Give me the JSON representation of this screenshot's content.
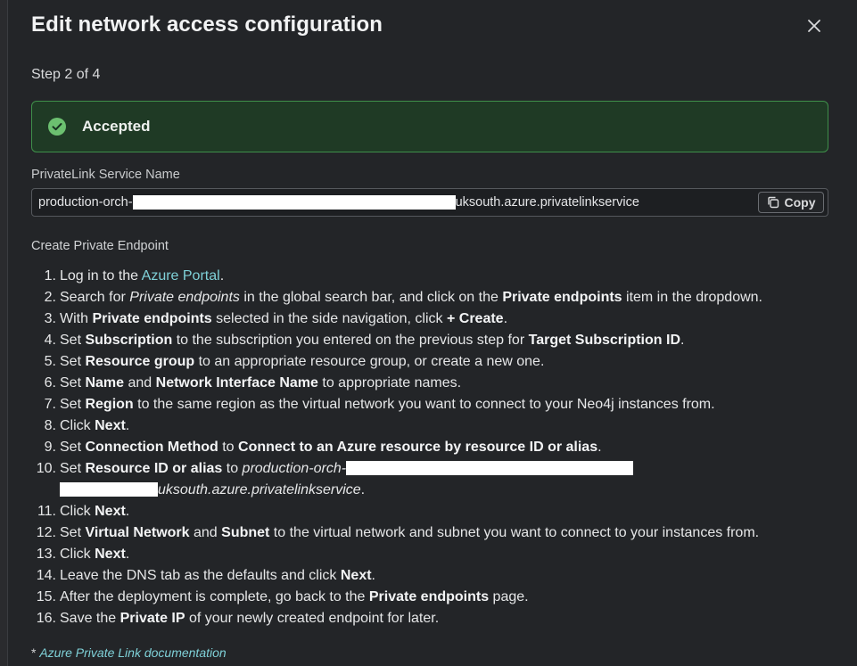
{
  "dialog": {
    "title": "Edit network access configuration",
    "step": "Step 2 of 4",
    "status": "Accepted",
    "colors": {
      "accent_link": "#7fd1d8",
      "success": "#3f8f4a",
      "background": "#232528"
    }
  },
  "service": {
    "label": "PrivateLink Service Name",
    "value_prefix": "production-orch-",
    "value_suffix": "uksouth.azure.privatelinkservice",
    "copy_label": "Copy"
  },
  "endpoint": {
    "heading": "Create Private Endpoint",
    "steps": [
      {
        "n": "1.",
        "parts": [
          [
            "Log in to the ",
            ""
          ],
          [
            "Azure Portal",
            "link"
          ],
          [
            ".",
            ""
          ]
        ]
      },
      {
        "n": "2.",
        "parts": [
          [
            "Search for ",
            ""
          ],
          [
            "Private endpoints",
            "i"
          ],
          [
            " in the global search bar, and click on the ",
            ""
          ],
          [
            "Private endpoints",
            "b"
          ],
          [
            " item in the dropdown.",
            ""
          ]
        ]
      },
      {
        "n": "3.",
        "parts": [
          [
            "With ",
            ""
          ],
          [
            "Private endpoints",
            "b"
          ],
          [
            " selected in the side navigation, click ",
            ""
          ],
          [
            "+ Create",
            "b"
          ],
          [
            ".",
            ""
          ]
        ]
      },
      {
        "n": "4.",
        "parts": [
          [
            "Set ",
            ""
          ],
          [
            "Subscription",
            "b"
          ],
          [
            " to the subscription you entered on the previous step for ",
            ""
          ],
          [
            "Target Subscription ID",
            "b"
          ],
          [
            ".",
            ""
          ]
        ]
      },
      {
        "n": "5.",
        "parts": [
          [
            "Set ",
            ""
          ],
          [
            "Resource group",
            "b"
          ],
          [
            " to an appropriate resource group, or create a new one.",
            ""
          ]
        ]
      },
      {
        "n": "6.",
        "parts": [
          [
            "Set ",
            ""
          ],
          [
            "Name",
            "b"
          ],
          [
            " and ",
            ""
          ],
          [
            "Network Interface Name",
            "b"
          ],
          [
            " to appropriate names.",
            ""
          ]
        ]
      },
      {
        "n": "7.",
        "parts": [
          [
            "Set ",
            ""
          ],
          [
            "Region",
            "b"
          ],
          [
            " to the same region as the virtual network you want to connect to your Neo4j instances from.",
            ""
          ]
        ]
      },
      {
        "n": "8.",
        "parts": [
          [
            "Click ",
            ""
          ],
          [
            "Next",
            "b"
          ],
          [
            ".",
            ""
          ]
        ]
      },
      {
        "n": "9.",
        "parts": [
          [
            "Set ",
            ""
          ],
          [
            "Connection Method",
            "b"
          ],
          [
            " to ",
            ""
          ],
          [
            "Connect to an Azure resource by resource ID or alias",
            "b"
          ],
          [
            ".",
            ""
          ]
        ]
      },
      {
        "n": "10.",
        "parts": [
          [
            "Set ",
            ""
          ],
          [
            "Resource ID or alias",
            "b"
          ],
          [
            " to ",
            ""
          ],
          [
            "production-orch-",
            "i"
          ],
          [
            "",
            "redact-long"
          ],
          [
            "",
            "br"
          ],
          [
            "",
            "redact-short"
          ],
          [
            "uksouth.azure.privatelinkservice",
            "i"
          ],
          [
            ".",
            ""
          ]
        ]
      },
      {
        "n": "11.",
        "parts": [
          [
            "Click ",
            ""
          ],
          [
            "Next",
            "b"
          ],
          [
            ".",
            ""
          ]
        ]
      },
      {
        "n": "12.",
        "parts": [
          [
            "Set ",
            ""
          ],
          [
            "Virtual Network",
            "b"
          ],
          [
            " and ",
            ""
          ],
          [
            "Subnet",
            "b"
          ],
          [
            " to the virtual network and subnet you want to connect to your instances from.",
            ""
          ]
        ]
      },
      {
        "n": "13.",
        "parts": [
          [
            "Click ",
            ""
          ],
          [
            "Next",
            "b"
          ],
          [
            ".",
            ""
          ]
        ]
      },
      {
        "n": "14.",
        "parts": [
          [
            "Leave the DNS tab as the defaults and click ",
            ""
          ],
          [
            "Next",
            "b"
          ],
          [
            ".",
            ""
          ]
        ]
      },
      {
        "n": "15.",
        "parts": [
          [
            "After the deployment is complete, go back to the ",
            ""
          ],
          [
            "Private endpoints",
            "b"
          ],
          [
            " page.",
            ""
          ]
        ]
      },
      {
        "n": "16.",
        "parts": [
          [
            "Save the ",
            ""
          ],
          [
            "Private IP",
            "b"
          ],
          [
            " of your newly created endpoint for later.",
            ""
          ]
        ]
      }
    ]
  },
  "footnote": {
    "marker": "* ",
    "link_label": "Azure Private Link documentation"
  }
}
